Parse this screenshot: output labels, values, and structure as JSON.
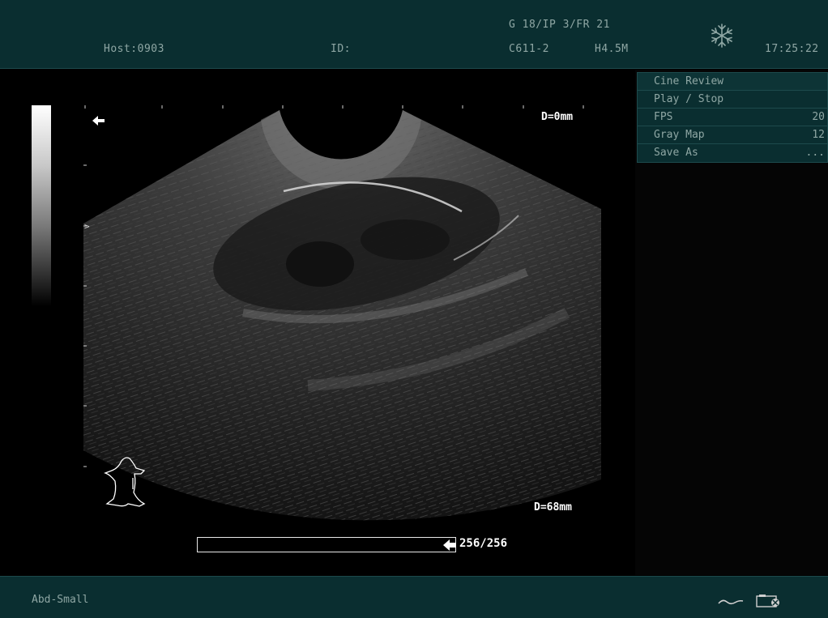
{
  "header": {
    "host": "Host:0903",
    "id": "ID:",
    "gain_info": "G 18/IP 3/FR 21",
    "probe": "C611-2",
    "frequency": "H4.5M",
    "time": "17:25:22",
    "freeze_icon": "snowflake-icon"
  },
  "cine_menu": {
    "title": "Cine Review",
    "items": [
      {
        "label": "Play / Stop",
        "value": ""
      },
      {
        "label": "FPS",
        "value": "20"
      },
      {
        "label": "Gray Map",
        "value": "12"
      },
      {
        "label": "Save As",
        "value": "..."
      }
    ]
  },
  "image": {
    "depth_top": "D=0mm",
    "depth_bottom": "D=68mm",
    "body_mark_icon": "dog-bodymark-icon",
    "orientation_icon": "left-arrow-icon",
    "focus_marker": ">"
  },
  "cine": {
    "counter": "256/256",
    "progress": 1.0
  },
  "footer": {
    "preset": "Abd-Small",
    "icons": [
      "wave-icon",
      "camera-icon"
    ]
  },
  "colors": {
    "panel_bg": "#0a2e30",
    "panel_border": "#1d4a4c",
    "text": "#8fa7a4"
  }
}
